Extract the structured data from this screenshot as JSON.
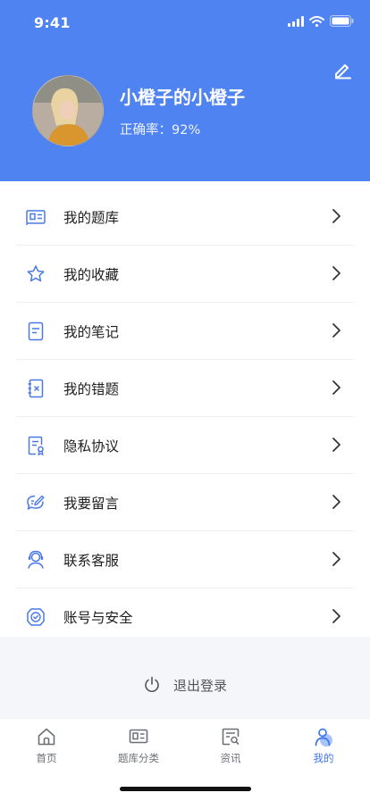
{
  "status_bar": {
    "time": "9:41"
  },
  "profile": {
    "username": "小橙子的小橙子",
    "accuracy": "正确率：92%"
  },
  "menu": [
    {
      "label": "我的题库",
      "icon": "question-bank-icon"
    },
    {
      "label": "我的收藏",
      "icon": "star-icon"
    },
    {
      "label": "我的笔记",
      "icon": "notes-icon"
    },
    {
      "label": "我的错题",
      "icon": "wrong-answers-icon"
    },
    {
      "label": "隐私协议",
      "icon": "privacy-document-icon"
    },
    {
      "label": "我要留言",
      "icon": "message-pen-icon"
    },
    {
      "label": "联系客服",
      "icon": "customer-service-icon"
    },
    {
      "label": "账号与安全",
      "icon": "shield-check-icon"
    }
  ],
  "logout": {
    "label": "退出登录",
    "icon": "power-icon"
  },
  "tabbar": [
    {
      "label": "首页",
      "icon": "home-icon",
      "active": false
    },
    {
      "label": "题库分类",
      "icon": "category-icon",
      "active": false
    },
    {
      "label": "资讯",
      "icon": "news-search-icon",
      "active": false
    },
    {
      "label": "我的",
      "icon": "user-icon",
      "active": true
    }
  ],
  "colors": {
    "primary": "#4f83f1",
    "active_tab": "#3d75ee",
    "icon": "#4a78e6"
  }
}
